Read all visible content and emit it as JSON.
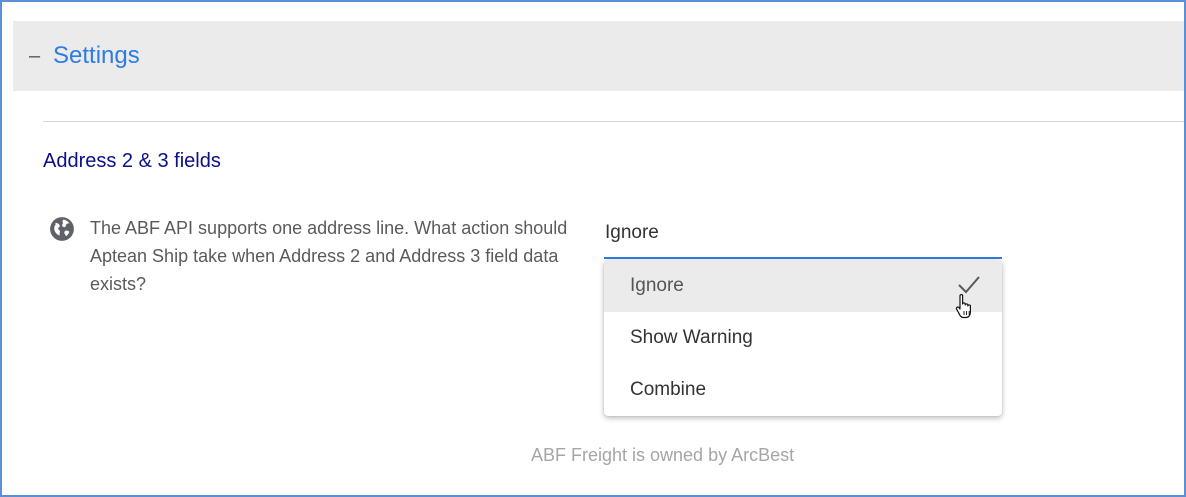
{
  "panel": {
    "collapse_symbol": "–",
    "title": "Settings"
  },
  "section": {
    "title": "Address 2 & 3 fields"
  },
  "setting": {
    "icon": "globe-icon",
    "description": "The ABF API supports one address line. What action should Aptean Ship take when Address 2 and Address 3 field data exists?",
    "selected_value": "Ignore",
    "options": [
      {
        "label": "Ignore",
        "selected": true
      },
      {
        "label": "Show Warning",
        "selected": false
      },
      {
        "label": "Combine",
        "selected": false
      }
    ]
  },
  "footer": {
    "note": "ABF Freight is owned by ArcBest"
  },
  "colors": {
    "accent": "#2d7ce6",
    "section_title": "#0a0f8a",
    "header_bg": "#ebebeb",
    "frame_border": "#5b8fd6"
  }
}
